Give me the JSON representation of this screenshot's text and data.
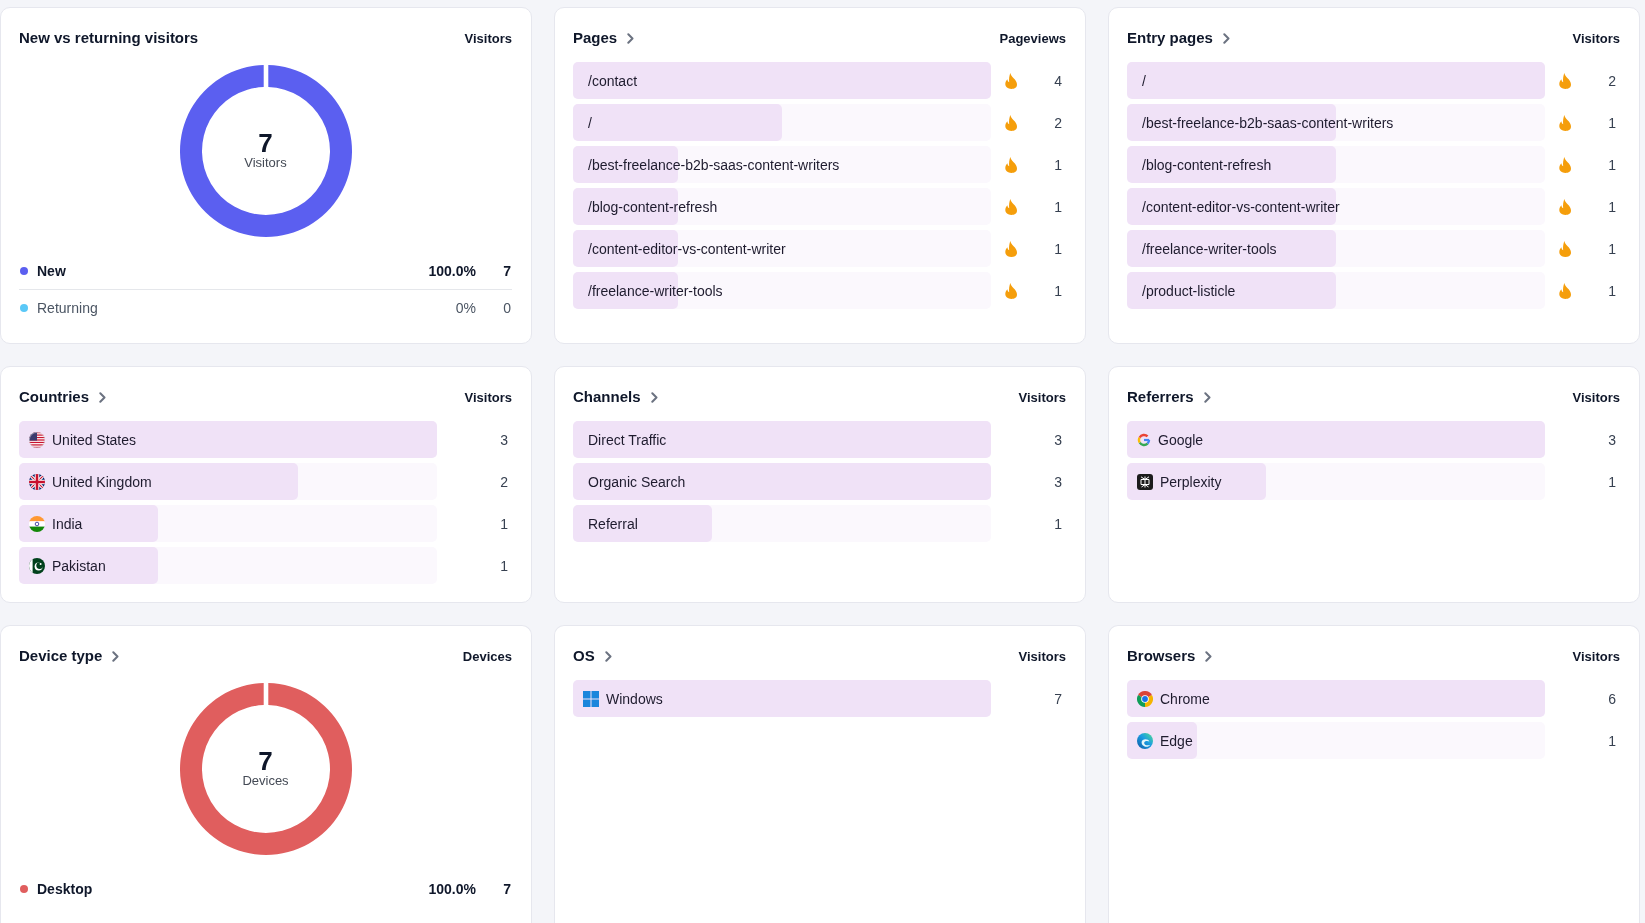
{
  "cards": [
    {
      "kind": "donut",
      "title": "New vs returning visitors",
      "linked": false,
      "column_header": "Visitors",
      "total": "7",
      "total_label": "Visitors",
      "legend": [
        {
          "label": "New",
          "percent": "100.0%",
          "value": "7",
          "color": "#5b5ff0",
          "highlighted": true
        },
        {
          "label": "Returning",
          "percent": "0%",
          "value": "0",
          "color": "#5ac8f7",
          "highlighted": false
        }
      ]
    },
    {
      "kind": "bars",
      "title": "Pages",
      "linked": true,
      "column_header": "Pageviews",
      "rows": [
        {
          "label": "/contact",
          "value": "4",
          "level": 1,
          "hot": true
        },
        {
          "label": "/",
          "value": "2",
          "level": 0.5,
          "hot": true
        },
        {
          "label": "/best-freelance-b2b-saas-content-writers",
          "value": "1",
          "level": 0.25,
          "hot": true
        },
        {
          "label": "/blog-content-refresh",
          "value": "1",
          "level": 0.25,
          "hot": true
        },
        {
          "label": "/content-editor-vs-content-writer",
          "value": "1",
          "level": 0.25,
          "hot": true
        },
        {
          "label": "/freelance-writer-tools",
          "value": "1",
          "level": 0.25,
          "hot": true
        }
      ]
    },
    {
      "kind": "bars",
      "title": "Entry pages",
      "linked": true,
      "column_header": "Visitors",
      "rows": [
        {
          "label": "/",
          "value": "2",
          "level": 1,
          "hot": true
        },
        {
          "label": "/best-freelance-b2b-saas-content-writers",
          "value": "1",
          "level": 0.5,
          "hot": true
        },
        {
          "label": "/blog-content-refresh",
          "value": "1",
          "level": 0.5,
          "hot": true
        },
        {
          "label": "/content-editor-vs-content-writer",
          "value": "1",
          "level": 0.5,
          "hot": true
        },
        {
          "label": "/freelance-writer-tools",
          "value": "1",
          "level": 0.5,
          "hot": true
        },
        {
          "label": "/product-listicle",
          "value": "1",
          "level": 0.5,
          "hot": true
        }
      ]
    },
    {
      "kind": "bars",
      "title": "Countries",
      "linked": true,
      "column_header": "Visitors",
      "rows": [
        {
          "label": "United States",
          "value": "3",
          "level": 1
        },
        {
          "label": "United Kingdom",
          "value": "2",
          "level": 0.667
        },
        {
          "label": "India",
          "value": "1",
          "level": 0.333
        },
        {
          "label": "Pakistan",
          "value": "1",
          "level": 0.333
        }
      ]
    },
    {
      "kind": "bars",
      "title": "Channels",
      "linked": true,
      "column_header": "Visitors",
      "rows": [
        {
          "label": "Direct Traffic",
          "value": "3",
          "level": 1
        },
        {
          "label": "Organic Search",
          "value": "3",
          "level": 1
        },
        {
          "label": "Referral",
          "value": "1",
          "level": 0.333
        }
      ]
    },
    {
      "kind": "bars",
      "title": "Referrers",
      "linked": true,
      "column_header": "Visitors",
      "rows": [
        {
          "label": "Google",
          "value": "3",
          "level": 1
        },
        {
          "label": "Perplexity",
          "value": "1",
          "level": 0.333
        }
      ]
    },
    {
      "kind": "donut",
      "title": "Device type",
      "linked": true,
      "column_header": "Devices",
      "total": "7",
      "total_label": "Devices",
      "legend": [
        {
          "label": "Desktop",
          "percent": "100.0%",
          "value": "7",
          "color": "#e05e5e",
          "highlighted": true
        }
      ]
    },
    {
      "kind": "bars",
      "title": "OS",
      "linked": true,
      "column_header": "Visitors",
      "rows": [
        {
          "label": "Windows",
          "value": "7",
          "level": 1
        }
      ]
    },
    {
      "kind": "bars",
      "title": "Browsers",
      "linked": true,
      "column_header": "Visitors",
      "rows": [
        {
          "label": "Chrome",
          "value": "6",
          "level": 1
        },
        {
          "label": "Edge",
          "value": "1",
          "level": 0.167
        }
      ]
    }
  ]
}
